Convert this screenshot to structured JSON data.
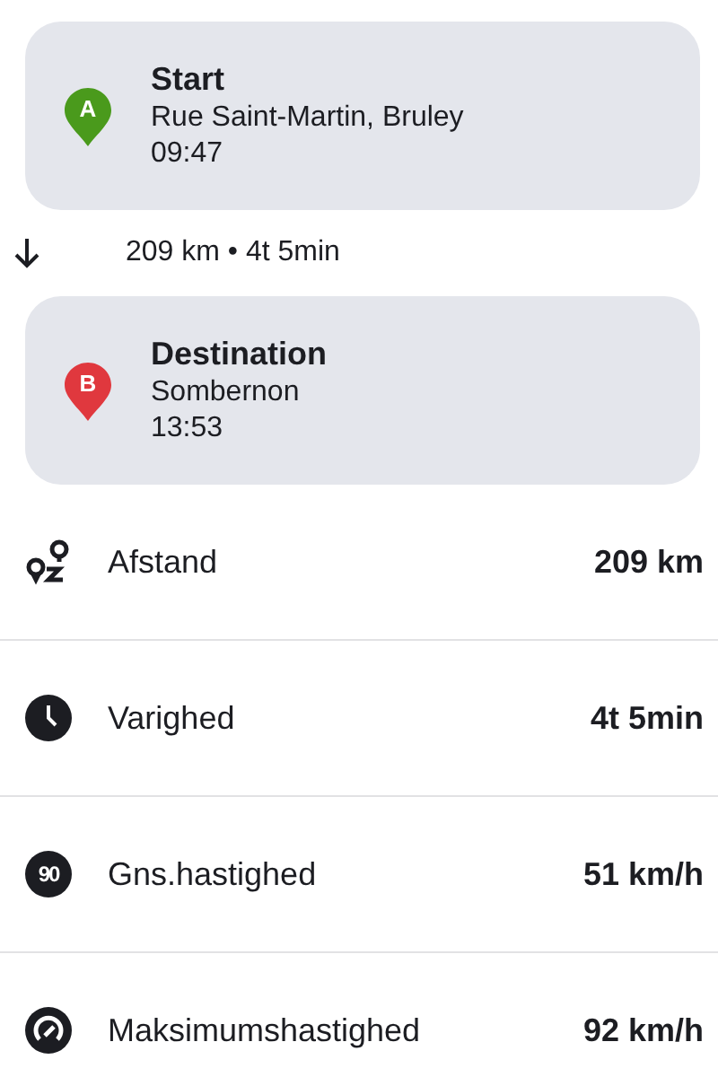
{
  "stops": [
    {
      "marker": "A",
      "color": "#4a9a1c",
      "title": "Start",
      "place": "Rue Saint-Martin, Bruley",
      "time": "09:47"
    },
    {
      "marker": "B",
      "color": "#e0383e",
      "title": "Destination",
      "place": "Sombernon",
      "time": "13:53"
    }
  ],
  "summary": "209 km • 4t 5min",
  "stats": [
    {
      "kind": "route",
      "label": "Afstand",
      "value": "209 km"
    },
    {
      "kind": "clock",
      "label": "Varighed",
      "value": "4t 5min"
    },
    {
      "kind": "speed-sign",
      "sign": "90",
      "label": "Gns.hastighed",
      "value": "51 km/h"
    },
    {
      "kind": "gauge",
      "label": "Maksimumshastighed",
      "value": "92 km/h"
    }
  ]
}
